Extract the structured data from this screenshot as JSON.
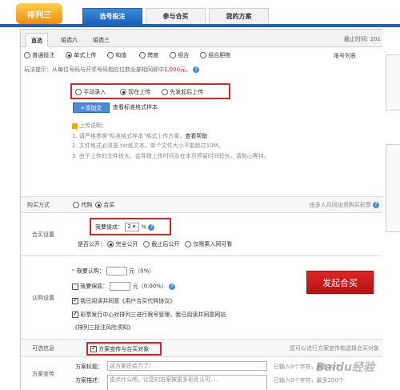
{
  "header": {
    "logo_text": "排列三",
    "tabs": [
      "选号投注",
      "参与合买",
      "我的方案"
    ],
    "active_tab": 0
  },
  "subtabs": {
    "items": [
      "直选",
      "组选六",
      "组选三"
    ],
    "active": 0,
    "deadline": "截止时间: 201"
  },
  "play_types": {
    "options": [
      "普通投注",
      "单式上传",
      "和值",
      "跨度",
      "组合",
      "组合胆拖"
    ],
    "selected": 1,
    "number_list": "限号列表"
  },
  "tips": {
    "prefix": "玩法提示：",
    "text": "从每位号码与开奖号码相应位数全部相同即中",
    "prize": "1,000元",
    "suffix": "。"
  },
  "upload": {
    "options": [
      "手动录入",
      "现在上传",
      "先发起后上传"
    ],
    "selected": 1,
    "add_text_button": "+添加文",
    "view_sample": "查看标准格式样本",
    "notes_title": "上传说明：",
    "note1_prefix": "1. 请严格参照\"标准格式样本\"格式上传方案，",
    "note1_link": "查看帮助",
    "note2": "2. 文件格式必须是.txt纸文本，单个文件大小不能超过10M。",
    "note3": "3. 由于上传的文件较大，会导致上传时间及在本页停留时间较长，请耐心等待。"
  },
  "buy_method": {
    "label": "购买方式",
    "options": [
      "代购",
      "合买"
    ],
    "selected": 1,
    "note": "由多人共同出资购买彩票"
  },
  "group_settings": {
    "label": "合买设置",
    "commission_label": "我要提成：",
    "commission_value": "2",
    "commission_unit": "%",
    "public_label": "是否公开：",
    "public_options": [
      "完全公开",
      "截止后公开",
      "仅限乘入网可看"
    ],
    "public_selected": 0
  },
  "subscription": {
    "label": "认购设置",
    "subscribe_label": "我要认购：",
    "subscribe_unit": "元（0%）",
    "guarantee_label": "我要保底：",
    "guarantee_unit": "元（0.00%）",
    "agree1": "我已阅读并同意《用户合买代购协议》",
    "agree2": "彩票发行中心对排列三进行限号管理，我已阅读并同意网站",
    "limit_notice": "《排列三投注风险须知》",
    "launch_button": "发起合买"
  },
  "optional": {
    "label": "可选信息",
    "checkbox_label": "方案宣传与合买对象",
    "right_note": "您可以进行方案宣传和选择合买对象"
  },
  "promotion": {
    "label": "方案宣传",
    "title_label": "方案标题：",
    "title_value": "这方案还给力了！",
    "title_hint": "已输入0个字符，最多20个",
    "desc_label": "方案描述：",
    "desc_placeholder": "说点什么吧，让您的方案被更多彩民认可．．．",
    "desc_hint": "已输入0个字符，最多200个"
  },
  "watermark": "Baidu经验"
}
